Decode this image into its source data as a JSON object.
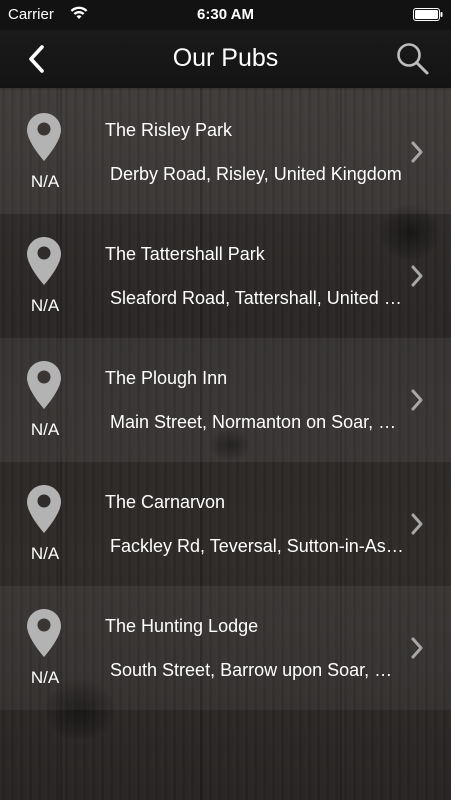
{
  "status_bar": {
    "carrier": "Carrier",
    "time": "6:30 AM"
  },
  "nav": {
    "title": "Our Pubs",
    "back_icon": "chevron-left-icon",
    "search_icon": "search-icon"
  },
  "pubs": [
    {
      "name": "The Risley Park",
      "address": "Derby Road, Risley, United Kingdom",
      "distance": "N/A"
    },
    {
      "name": "The Tattershall Park",
      "address": "Sleaford Road, Tattershall, United Kingdom",
      "distance": "N/A"
    },
    {
      "name": "The Plough Inn",
      "address": "Main Street, Normanton on Soar, United Kingdom",
      "distance": "N/A"
    },
    {
      "name": "The Carnarvon",
      "address": "Fackley Rd, Teversal, Sutton-in-Ashfield, United Kingdom",
      "distance": "N/A"
    },
    {
      "name": "The Hunting Lodge",
      "address": "South Street, Barrow upon Soar, United Kingdom",
      "distance": "N/A"
    }
  ],
  "colors": {
    "bar_background": "#141414",
    "text": "#ffffff",
    "icon_grey": "#b3b3b3"
  }
}
